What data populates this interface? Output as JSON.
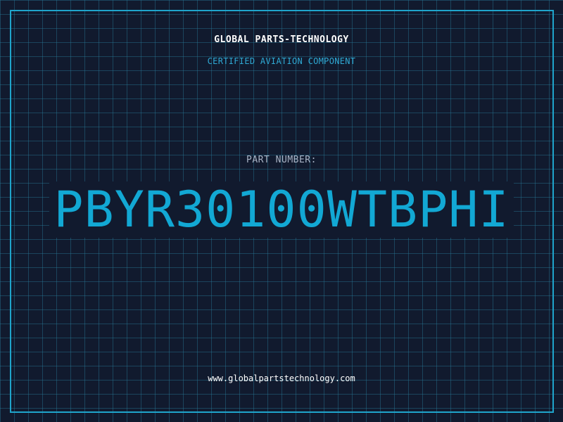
{
  "header": {
    "company": "GLOBAL PARTS-TECHNOLOGY",
    "subtitle": "CERTIFIED AVIATION COMPONENT"
  },
  "part": {
    "label": "PART NUMBER:",
    "number": "PBYR30100WTBPHI"
  },
  "footer": {
    "website": "www.globalpartstechnology.com"
  },
  "colors": {
    "background": "#111a2e",
    "grid": "#287896",
    "frame": "#1fa5cc",
    "accent": "#12a8d4"
  }
}
